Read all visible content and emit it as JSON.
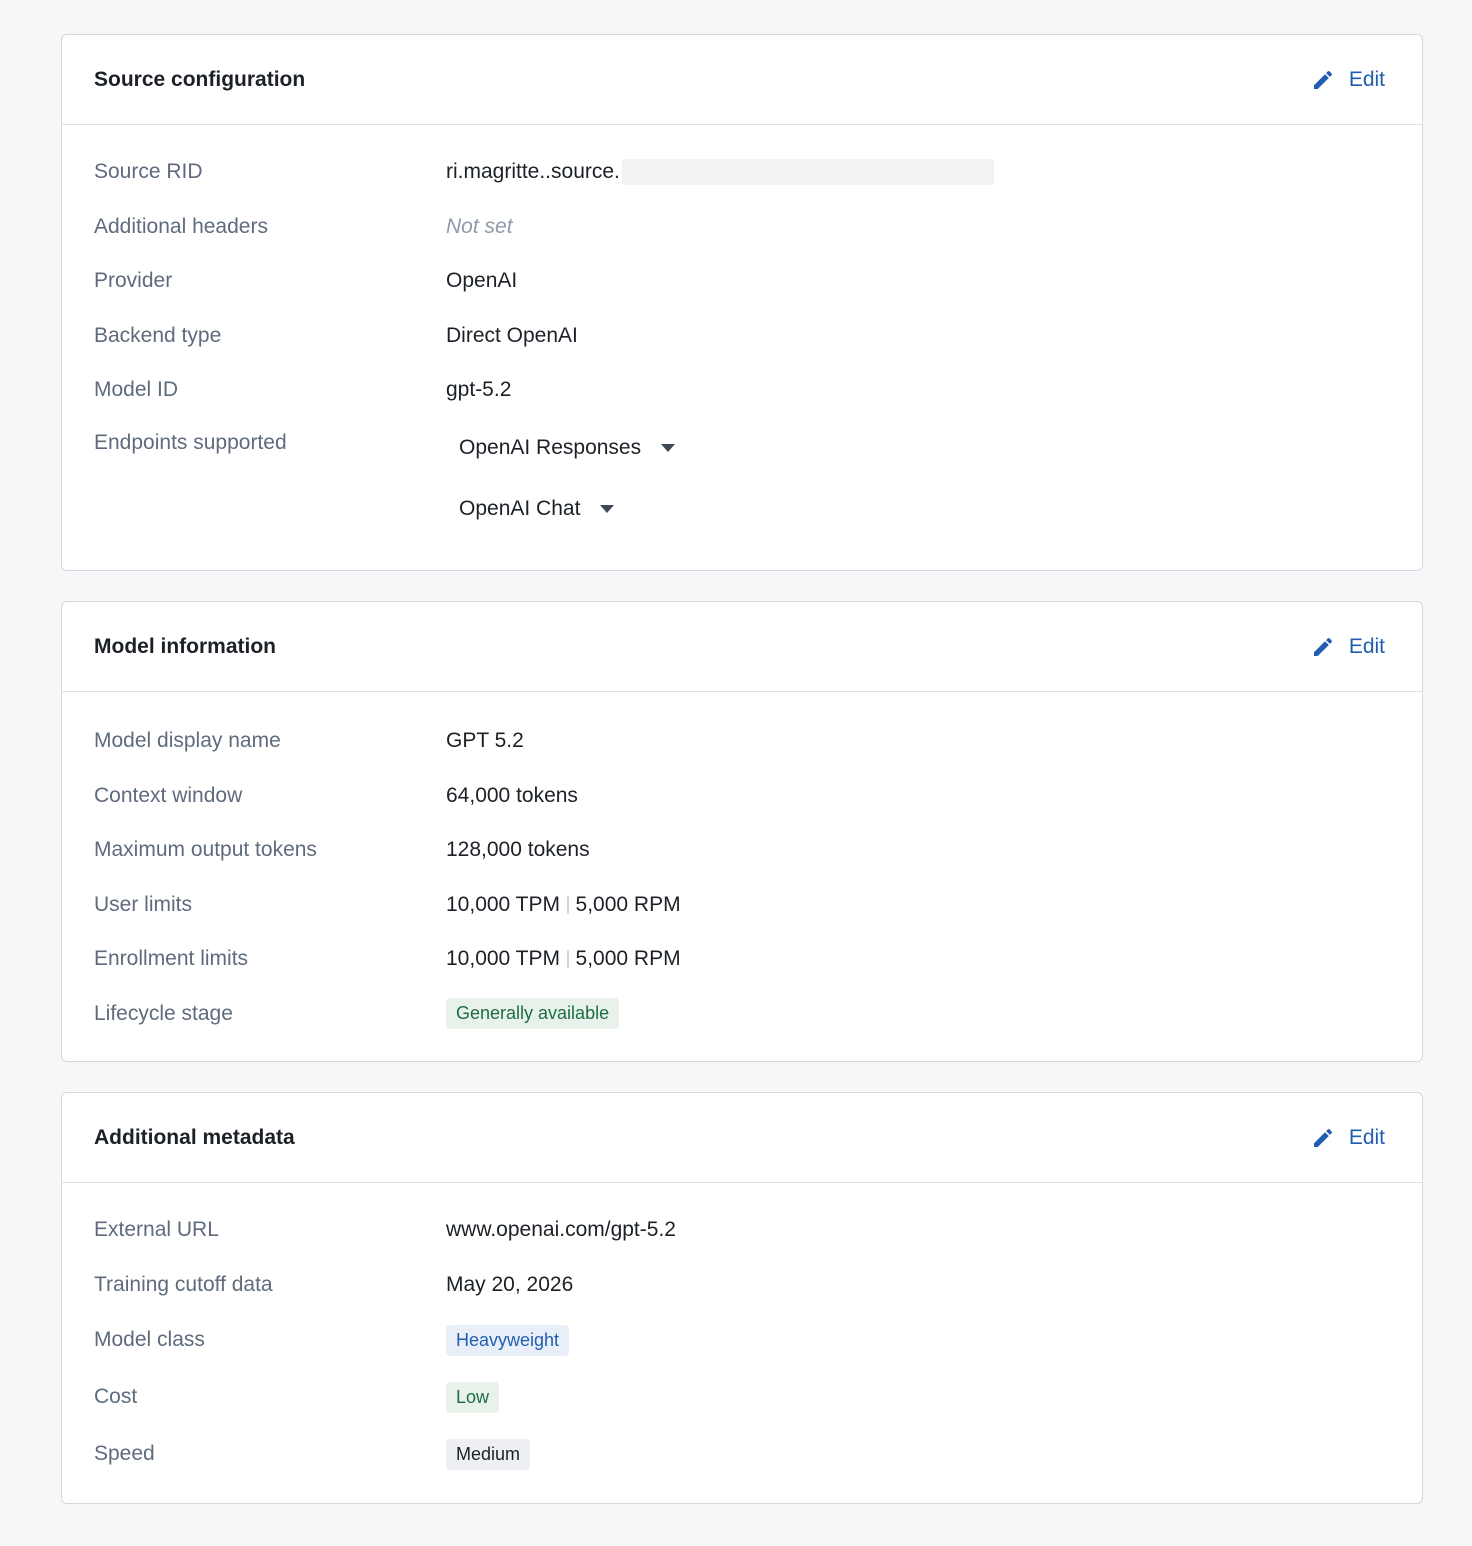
{
  "source_config": {
    "title": "Source configuration",
    "edit_label": "Edit",
    "rows": [
      {
        "label": "Source RID",
        "value": "ri.magritte..source."
      },
      {
        "label": "Additional headers",
        "value": "Not set"
      },
      {
        "label": "Provider",
        "value": "OpenAI"
      },
      {
        "label": "Backend type",
        "value": "Direct OpenAI"
      },
      {
        "label": "Model ID",
        "value": "gpt-5.2"
      }
    ],
    "endpoints_label": "Endpoints supported",
    "endpoints": [
      "OpenAI Responses",
      "OpenAI Chat"
    ]
  },
  "model_info": {
    "title": "Model information",
    "edit_label": "Edit",
    "rows": [
      {
        "label": "Model display name",
        "value": "GPT 5.2"
      },
      {
        "label": "Context window",
        "value": "64,000 tokens"
      },
      {
        "label": "Maximum output tokens",
        "value": "128,000 tokens"
      },
      {
        "label": "User limits",
        "tpm": "10,000 TPM",
        "rpm": "5,000 RPM"
      },
      {
        "label": "Enrollment limits",
        "tpm": "10,000 TPM",
        "rpm": "5,000 RPM"
      },
      {
        "label": "Lifecycle stage",
        "value": "Generally available"
      }
    ]
  },
  "metadata": {
    "title": "Additional metadata",
    "edit_label": "Edit",
    "rows": [
      {
        "label": "External URL",
        "value": "www.openai.com/gpt-5.2"
      },
      {
        "label": "Training cutoff data",
        "value": "May 20, 2026"
      },
      {
        "label": "Model class",
        "value": "Heavyweight"
      },
      {
        "label": "Cost",
        "value": "Low"
      },
      {
        "label": "Speed",
        "value": "Medium"
      }
    ]
  },
  "colors": {
    "accent": "#215db0",
    "success_tag_bg": "#e8f1ea",
    "success_tag_text": "#1c6e42",
    "primary_tag_bg": "#e9eff8",
    "neutral_tag_bg": "#edeff2"
  },
  "icons": {
    "edit": "pencil-icon",
    "dropdown": "caret-down-icon"
  }
}
